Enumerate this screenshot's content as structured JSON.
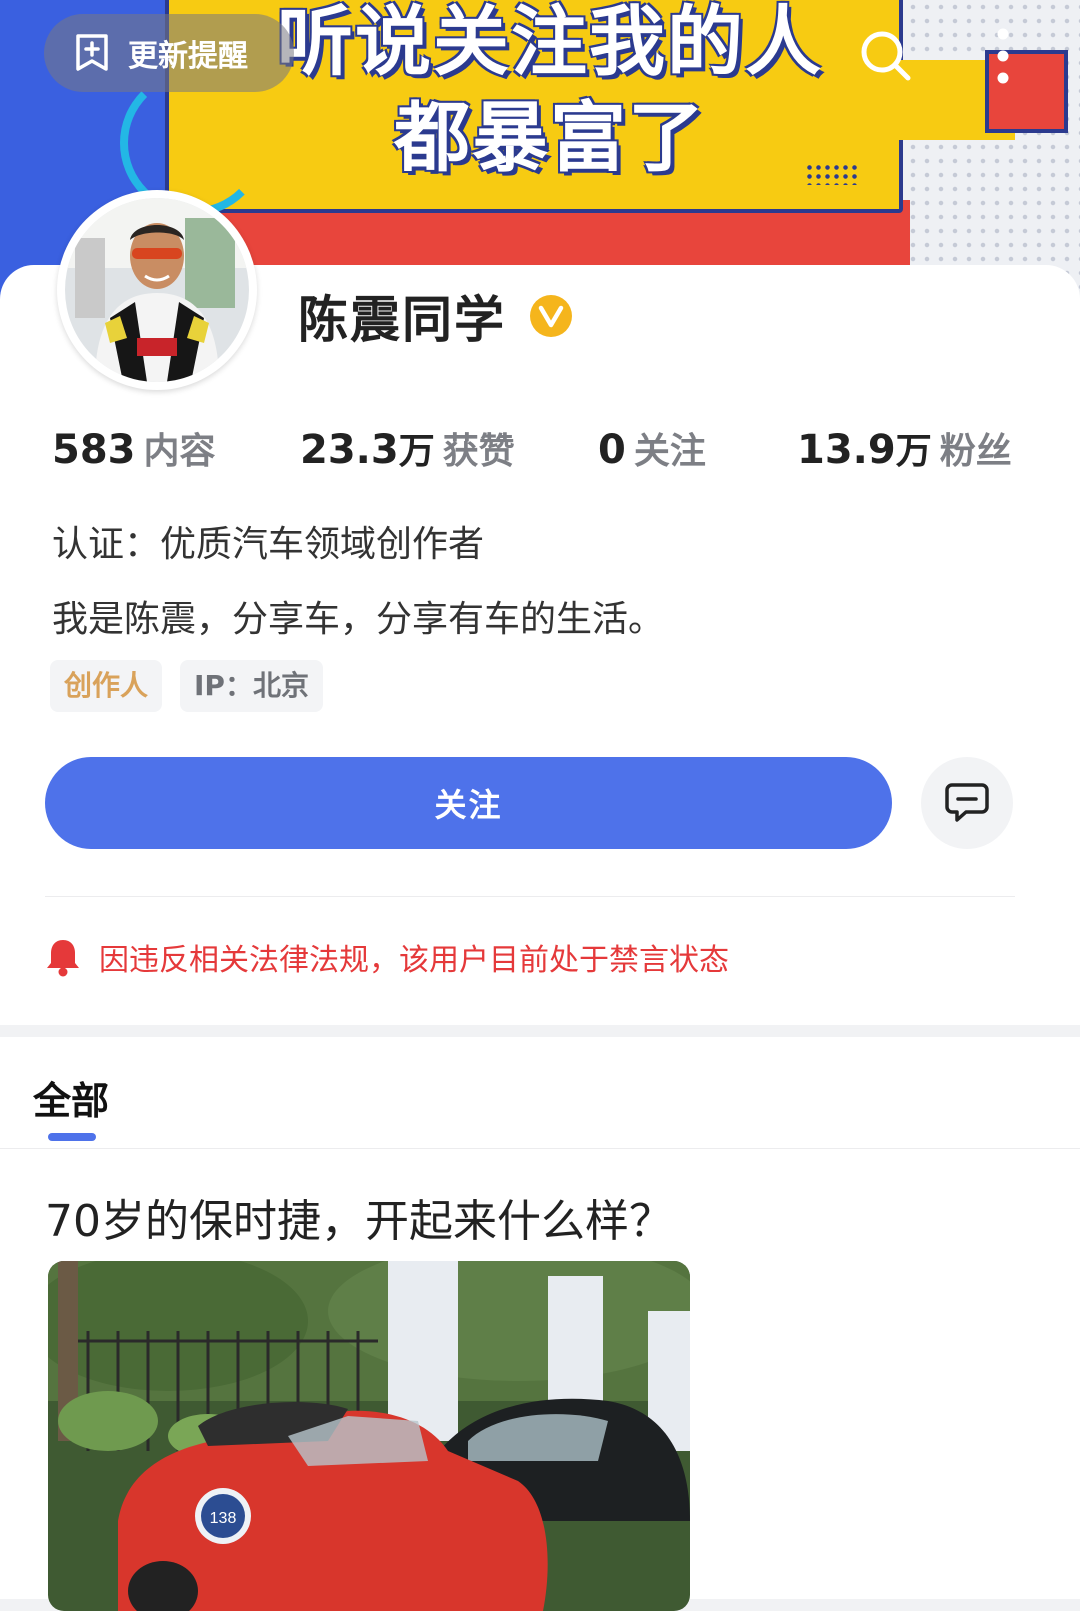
{
  "top_bar": {
    "update_reminder_label": "更新提醒",
    "search_icon": "search-icon",
    "more_icon": "more-vertical-icon"
  },
  "banner": {
    "line1": "听说关注我的人",
    "line2": "都暴富了"
  },
  "profile": {
    "name": "陈震同学",
    "verified": true,
    "stats": [
      {
        "value": "583",
        "unit": "",
        "label": "内容"
      },
      {
        "value": "23.3",
        "unit": "万",
        "label": "获赞"
      },
      {
        "value": "0",
        "unit": "",
        "label": "关注"
      },
      {
        "value": "13.9",
        "unit": "万",
        "label": "粉丝"
      }
    ],
    "certification": "认证：优质汽车领域创作者",
    "bio": "我是陈震，分享车，分享有车的生活。",
    "tags": [
      "创作人",
      "IP：北京"
    ],
    "follow_label": "关注",
    "warning": "因违反相关法律法规，该用户目前处于禁言状态"
  },
  "feed": {
    "tab_all": "全部",
    "posts": [
      {
        "title": "70岁的保时捷，开起来什么样？"
      }
    ]
  },
  "colors": {
    "primary": "#4e72ea",
    "warning": "#e5393a",
    "verify": "#f5b51c",
    "creator_tag": "#d9a25a"
  }
}
